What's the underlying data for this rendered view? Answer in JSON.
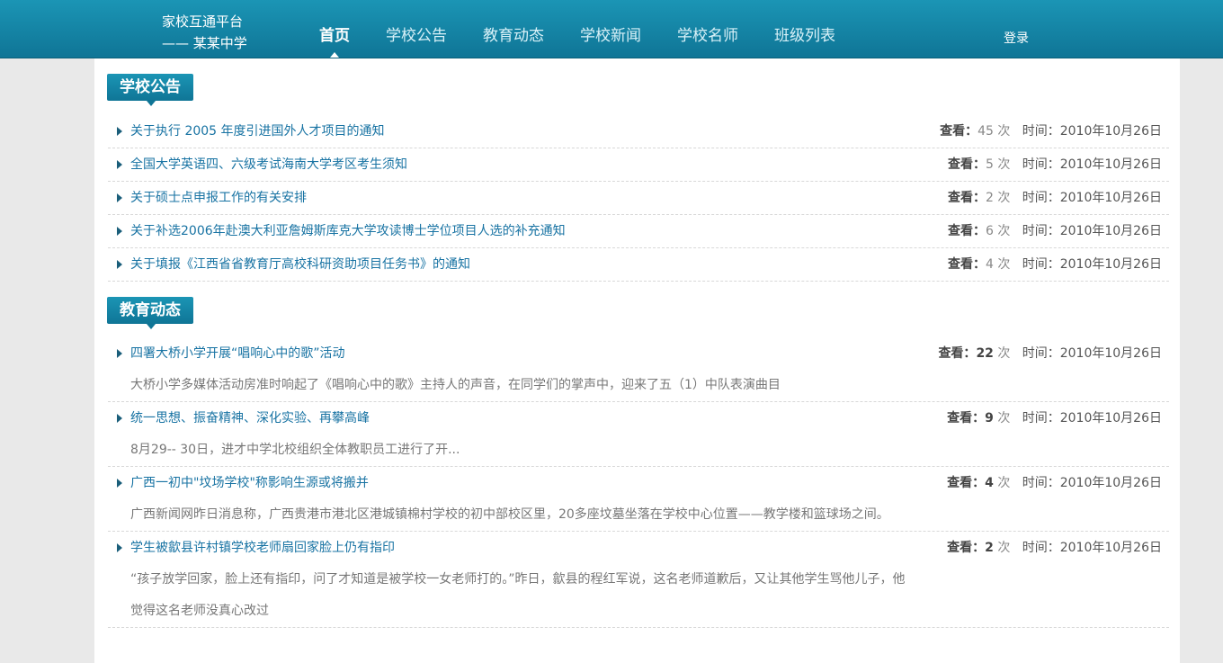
{
  "brand": {
    "line1": "家校互通平台",
    "line2": "—— 某某中学"
  },
  "nav": [
    {
      "label": "首页",
      "active": true
    },
    {
      "label": "学校公告"
    },
    {
      "label": "教育动态"
    },
    {
      "label": "学校新闻"
    },
    {
      "label": "学校名师"
    },
    {
      "label": "班级列表"
    }
  ],
  "login": "登录",
  "notices": {
    "tag": "学校公告",
    "view_label": "查看：",
    "times_unit": "次",
    "time_label": "时间：",
    "items": [
      {
        "title": "关于执行 2005 年度引进国外人才项目的通知",
        "views": "45",
        "date": "2010年10月26日"
      },
      {
        "title": "全国大学英语四、六级考试海南大学考区考生须知",
        "views": "5",
        "date": "2010年10月26日"
      },
      {
        "title": "关于硕士点申报工作的有关安排",
        "views": "2",
        "date": "2010年10月26日"
      },
      {
        "title": "关于补选2006年赴澳大利亚詹姆斯库克大学攻读博士学位项目人选的补充通知",
        "views": "6",
        "date": "2010年10月26日"
      },
      {
        "title": "关于填报《江西省省教育厅高校科研资助项目任务书》的通知",
        "views": "4",
        "date": "2010年10月26日"
      }
    ]
  },
  "news": {
    "tag": "教育动态",
    "view_label": "查看：",
    "times_unit": "次",
    "time_label": "时间：",
    "items": [
      {
        "title": "四署大桥小学开展“唱响心中的歌”活动",
        "views": "22",
        "date": "2010年10月26日",
        "desc": "大桥小学多媒体活动房准时响起了《唱响心中的歌》主持人的声音，在同学们的掌声中，迎来了五（1）中队表演曲目"
      },
      {
        "title": "统一思想、振奋精神、深化实验、再攀高峰",
        "views": "9",
        "date": "2010年10月26日",
        "desc": "8月29-- 30日，进才中学北校组织全体教职员工进行了开..."
      },
      {
        "title": "广西一初中\"坟场学校\"称影响生源或将搬并",
        "views": "4",
        "date": "2010年10月26日",
        "desc": "广西新闻网昨日消息称，广西贵港市港北区港城镇棉村学校的初中部校区里，20多座坟墓坐落在学校中心位置——教学楼和篮球场之间。"
      },
      {
        "title": "学生被歙县许村镇学校老师扇回家脸上仍有指印",
        "views": "2",
        "date": "2010年10月26日",
        "desc": "“孩子放学回家，脸上还有指印，问了才知道是被学校一女老师打的。”昨日，歙县的程红军说，这名老师道歉后，又让其他学生骂他儿子，他觉得这名老师没真心改过"
      }
    ]
  }
}
